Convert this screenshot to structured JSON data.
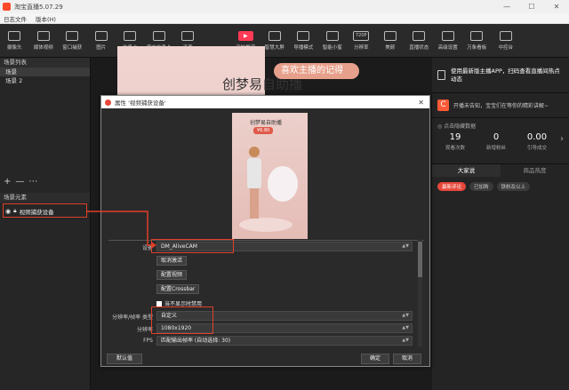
{
  "window": {
    "title": "淘宝直播5.07.29",
    "controls": [
      "—",
      "☐",
      "✕"
    ]
  },
  "menu": [
    "日志文件",
    "版本(H)"
  ],
  "toolbar": [
    {
      "label": "摄像头",
      "icon": "camera-icon"
    },
    {
      "label": "媒体视频",
      "icon": "play-icon"
    },
    {
      "label": "窗口捕获",
      "icon": "window-icon"
    },
    {
      "label": "图片",
      "icon": "image-icon"
    },
    {
      "label": "信息卡",
      "icon": "card-icon"
    },
    {
      "label": "官方信息卡",
      "icon": "official-card-icon"
    },
    {
      "label": "连麦",
      "icon": "phone-icon"
    },
    {
      "label": "",
      "icon": "blank"
    },
    {
      "label": "开始推流",
      "icon": "live-icon"
    },
    {
      "label": "智慧大屏",
      "icon": "screen-icon"
    },
    {
      "label": "导播模式",
      "icon": "director-icon"
    },
    {
      "label": "智能小蜜",
      "icon": "assistant-icon"
    },
    {
      "label": "分辨率",
      "icon": "resolution-icon",
      "badge": "720P"
    },
    {
      "label": "美颜",
      "icon": "beauty-icon"
    },
    {
      "label": "直播状态",
      "icon": "status-icon"
    },
    {
      "label": "高级设置",
      "icon": "settings-icon"
    },
    {
      "label": "万象看板",
      "icon": "dashboard-icon"
    },
    {
      "label": "中控台",
      "icon": "console-icon"
    }
  ],
  "left": {
    "scenes_header": "场景列表",
    "scenes": [
      "场景",
      "场景 2"
    ],
    "scene_controls": [
      "+",
      "—",
      "⋯"
    ],
    "elements_header": "场景元素",
    "element": "视频捕获设备"
  },
  "preview": {
    "brand": "创梦易自助播",
    "banner": "喜欢主播的记得"
  },
  "right": {
    "promo": "使用最新版主播APP，扫码查看直播间热点动态",
    "notice": "开播未告知，宝宝们在等你的精彩讲解~",
    "stats_header": "点击隐藏数据",
    "stats": [
      {
        "value": "19",
        "label": "观看次数"
      },
      {
        "value": "0",
        "label": "新增粉丝"
      },
      {
        "value": "0.00",
        "label": "引导成交"
      }
    ],
    "tabs": [
      "大家说",
      "商品热度"
    ],
    "chips": [
      "最新评论",
      "已加购",
      "铁粉及以上"
    ]
  },
  "dialog": {
    "title": "属性 '视频捕获设备'",
    "preview_title": "创梦易自助播",
    "preview_badge": "¥6.80",
    "device_label": "设备",
    "device_value": "DM_AliveCAM",
    "btn_deactivate": "取消激活",
    "btn_config_video": "配置视频",
    "btn_crossbar": "配置Crossbar",
    "checkbox_label": "当不显示时禁用",
    "res_type_label": "分辨率/帧率 类型",
    "res_type_value": "自定义",
    "resolution_label": "分辨率",
    "resolution_value": "1080x1920",
    "fps_label": "FPS",
    "fps_value": "匹配输出帧率 (自动选择: 30)",
    "default_button": "默认值",
    "ok_button": "确定",
    "cancel_button": "取消"
  },
  "colors": {
    "accent": "#e8473b",
    "live": "#ff3a55",
    "highlight_box": "#e0402a"
  }
}
